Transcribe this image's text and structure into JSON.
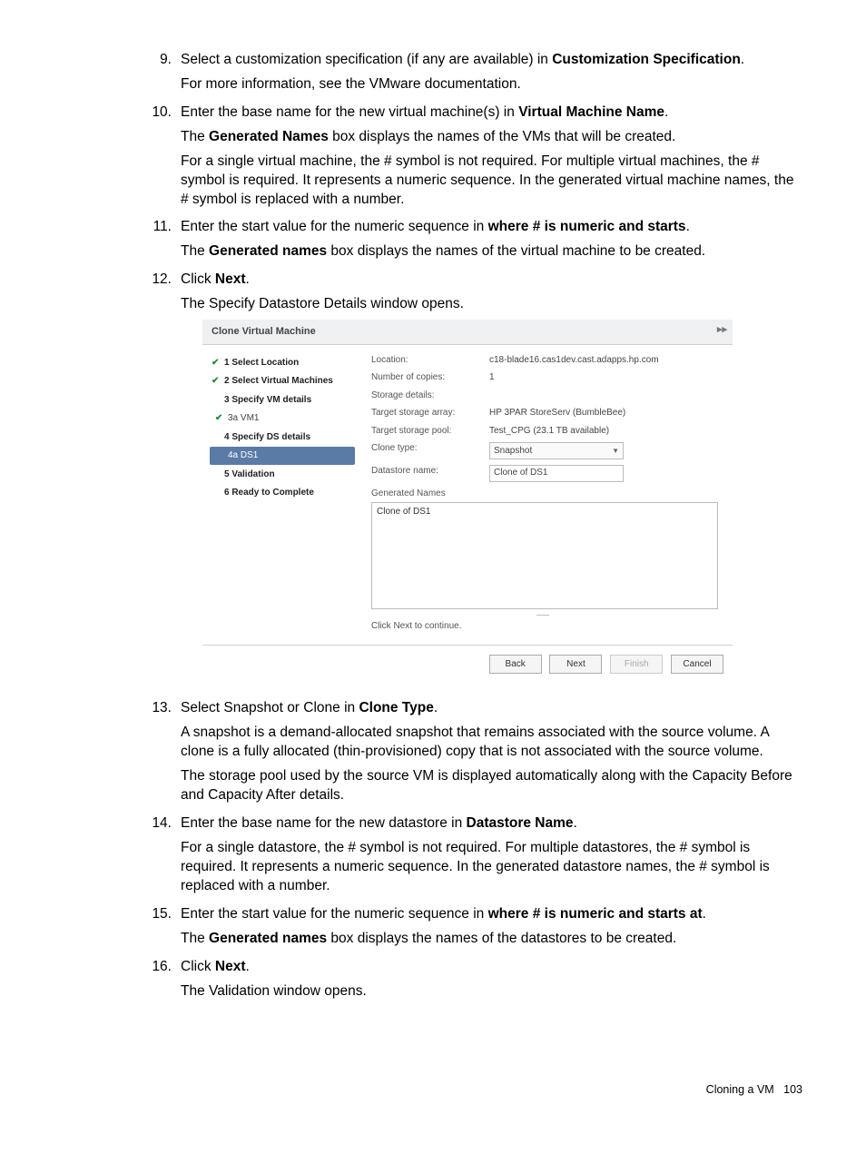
{
  "steps": {
    "s9": {
      "num": "9.",
      "line1_a": "Select a customization specification (if any are available) in ",
      "line1_bold": "Customization Specification",
      "line1_b": ".",
      "p1": "For more information, see the VMware documentation."
    },
    "s10": {
      "num": "10.",
      "line1_a": "Enter the base name for the new virtual machine(s) in ",
      "line1_bold": "Virtual Machine Name",
      "line1_b": ".",
      "p1_a": "The ",
      "p1_bold": "Generated Names",
      "p1_b": " box displays the names of the VMs that will be created.",
      "p2": "For a single virtual machine, the # symbol is not required. For multiple virtual machines, the # symbol is required. It represents a numeric sequence. In the generated virtual machine names, the # symbol is replaced with a number."
    },
    "s11": {
      "num": "11.",
      "line1_a": "Enter the start value for the numeric sequence in ",
      "line1_bold": "where # is numeric and starts",
      "line1_b": ".",
      "p1_a": "The ",
      "p1_bold": "Generated names",
      "p1_b": " box displays the names of the virtual machine to be created."
    },
    "s12": {
      "num": "12.",
      "line1_a": "Click ",
      "line1_bold": "Next",
      "line1_b": ".",
      "p1": "The Specify Datastore Details window opens."
    },
    "s13": {
      "num": "13.",
      "line1_a": "Select Snapshot or Clone in ",
      "line1_bold": "Clone Type",
      "line1_b": ".",
      "p1": "A snapshot is a demand-allocated snapshot that remains associated with the source volume. A clone is a fully allocated (thin-provisioned) copy that is not associated with the source volume.",
      "p2": "The storage pool used by the source VM is displayed automatically along with the Capacity Before and Capacity After details."
    },
    "s14": {
      "num": "14.",
      "line1_a": "Enter the base name for the new datastore in ",
      "line1_bold": "Datastore Name",
      "line1_b": ".",
      "p1": "For a single datastore, the # symbol is not required. For multiple datastores, the # symbol is required. It represents a numeric sequence. In the generated datastore names, the # symbol is replaced with a number."
    },
    "s15": {
      "num": "15.",
      "line1_a": "Enter the start value for the numeric sequence in ",
      "line1_bold": "where # is numeric and starts at",
      "line1_b": ".",
      "p1_a": "The ",
      "p1_bold": "Generated names",
      "p1_b": " box displays the names of the datastores to be created."
    },
    "s16": {
      "num": "16.",
      "line1_a": "Click ",
      "line1_bold": "Next",
      "line1_b": ".",
      "p1": "The Validation window opens."
    }
  },
  "dialog": {
    "title": "Clone Virtual Machine",
    "steps": {
      "s1": "1  Select Location",
      "s2": "2  Select Virtual Machines",
      "s3": "3  Specify VM details",
      "s3a": "3a  VM1",
      "s4": "4  Specify DS details",
      "s4a": "4a  DS1",
      "s5": "5  Validation",
      "s6": "6  Ready to Complete"
    },
    "labels": {
      "location": "Location:",
      "copies": "Number of copies:",
      "storage_details": "Storage details:",
      "target_array": "Target storage array:",
      "target_pool": "Target storage pool:",
      "clone_type": "Clone type:",
      "ds_name": "Datastore name:",
      "gen_names": "Generated Names"
    },
    "values": {
      "location": "c18-blade16.cas1dev.cast.adapps.hp.com",
      "copies": "1",
      "target_array": "HP 3PAR StoreServ (BumbleBee)",
      "target_pool": "Test_CPG (23.1 TB available)",
      "clone_type": "Snapshot",
      "ds_name": "Clone of DS1",
      "gen_box": "Clone of DS1"
    },
    "hint": "Click Next to continue.",
    "buttons": {
      "back": "Back",
      "next": "Next",
      "finish": "Finish",
      "cancel": "Cancel"
    }
  },
  "footer": {
    "text": "Cloning a VM",
    "page": "103"
  }
}
